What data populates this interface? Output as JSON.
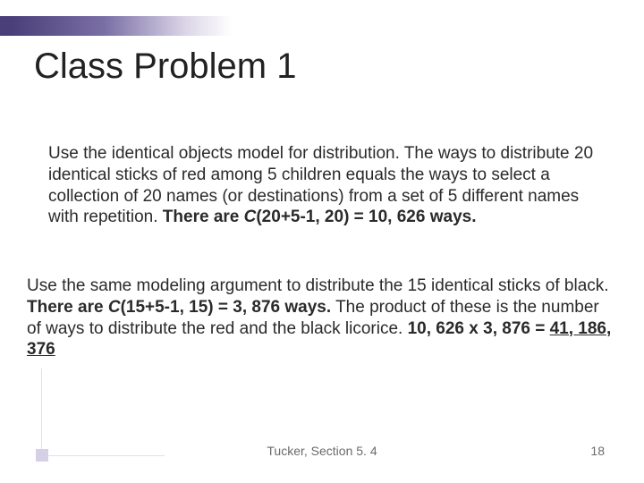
{
  "title": "Class Problem 1",
  "p1_a": "Use the identical objects model for distribution.  The ways to distribute 20 identical sticks of red among 5 children equals the ways to select a collection of 20 names (or destinations) from a set of 5 different names with repetition.   ",
  "p1_b_pre": "There are ",
  "p1_b_c": "C",
  "p1_b_post": "(20+5-1, 20) = 10, 626 ways.",
  "p2_a": "Use the same modeling argument to distribute the 15 identical sticks of black. ",
  "p2_b_pre": "There are ",
  "p2_b_c": "C",
  "p2_b_post": "(15+5-1, 15) = 3, 876 ways.",
  "p2_c": "  The product of these is the number of ways to distribute the red and the black licorice. ",
  "p2_d_pre": "10, 626 x 3, 876 = ",
  "p2_d_ans": "41, 186, 376",
  "footer_center": "Tucker, Section 5. 4",
  "footer_right": "18"
}
